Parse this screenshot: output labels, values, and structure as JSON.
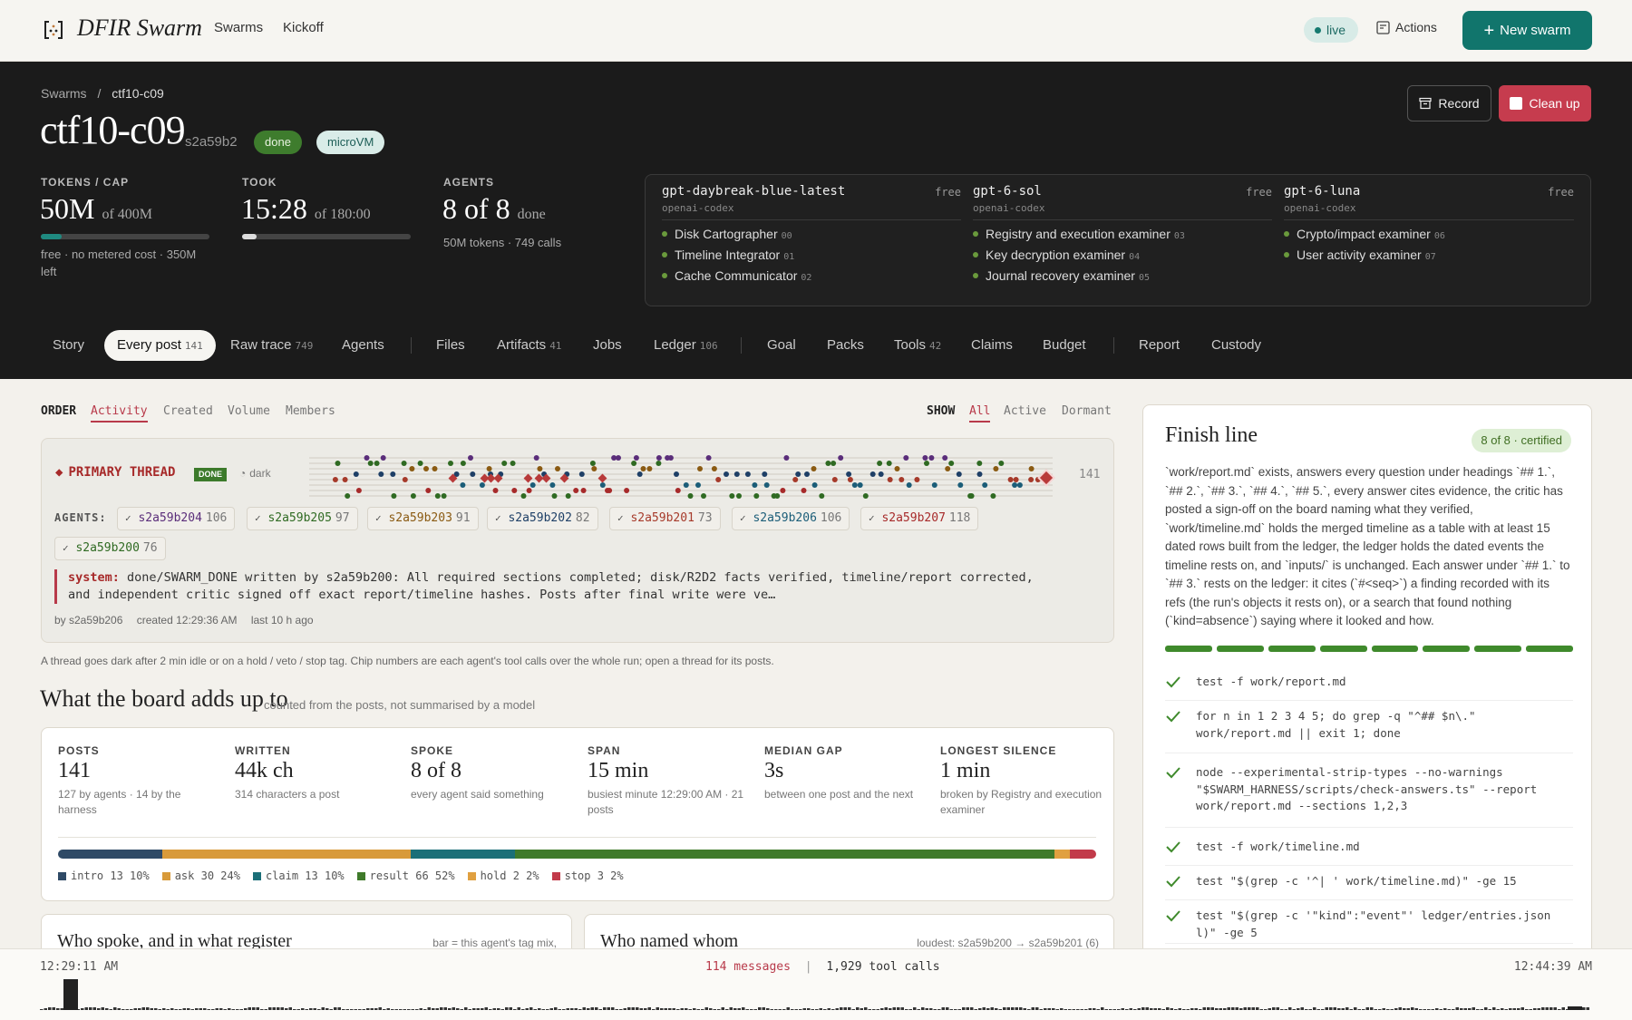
{
  "nav": {
    "brand": "DFIR Swarm",
    "links": [
      "Swarms",
      "Kickoff"
    ],
    "live": "live",
    "actions": "Actions",
    "new_swarm": "New swarm"
  },
  "header": {
    "breadcrumb": {
      "root": "Swarms",
      "sep": "/",
      "current": "ctf10-c09"
    },
    "title": "ctf10-c09",
    "id": "s2a59b2",
    "status": "done",
    "runtime": "microVM",
    "record": "Record",
    "cleanup": "Clean up",
    "stats": [
      {
        "label": "TOKENS / CAP",
        "value": "50M",
        "suffix": "of 400M",
        "sub": "free · no metered cost · 350M left",
        "progress": 0.125
      },
      {
        "label": "TOOK",
        "value": "15:28",
        "suffix": "of 180:00",
        "sub": "",
        "progress": 0.086
      },
      {
        "label": "AGENTS",
        "value": "8 of 8",
        "suffix": "done",
        "sub": "50M tokens · 749 calls"
      }
    ],
    "models": [
      {
        "name": "gpt-daybreak-blue-latest",
        "provider": "openai-codex",
        "tier": "free",
        "roles": [
          {
            "name": "Disk Cartographer",
            "n": "00"
          },
          {
            "name": "Timeline Integrator",
            "n": "01"
          },
          {
            "name": "Cache Communicator",
            "n": "02"
          }
        ]
      },
      {
        "name": "gpt-6-sol",
        "provider": "openai-codex",
        "tier": "free",
        "roles": [
          {
            "name": "Registry and execution examiner",
            "n": "03"
          },
          {
            "name": "Key decryption examiner",
            "n": "04"
          },
          {
            "name": "Journal recovery examiner",
            "n": "05"
          }
        ]
      },
      {
        "name": "gpt-6-luna",
        "provider": "openai-codex",
        "tier": "free",
        "roles": [
          {
            "name": "Crypto/impact examiner",
            "n": "06"
          },
          {
            "name": "User activity examiner",
            "n": "07"
          }
        ]
      }
    ],
    "tabs": [
      {
        "label": "Story",
        "count": ""
      },
      {
        "label": "Every post",
        "count": "141"
      },
      {
        "label": "Raw trace",
        "count": "749"
      },
      {
        "label": "Agents",
        "count": ""
      },
      {
        "label": "Files",
        "count": ""
      },
      {
        "label": "Artifacts",
        "count": "41"
      },
      {
        "label": "Jobs",
        "count": ""
      },
      {
        "label": "Ledger",
        "count": "106"
      },
      {
        "label": "Goal",
        "count": ""
      },
      {
        "label": "Packs",
        "count": ""
      },
      {
        "label": "Tools",
        "count": "42"
      },
      {
        "label": "Claims",
        "count": ""
      },
      {
        "label": "Budget",
        "count": ""
      },
      {
        "label": "Report",
        "count": ""
      },
      {
        "label": "Custody",
        "count": ""
      }
    ]
  },
  "order": {
    "label": "ORDER",
    "options": [
      "Activity",
      "Created",
      "Volume",
      "Members"
    ],
    "active": "Activity"
  },
  "show": {
    "label": "SHOW",
    "options": [
      "All",
      "Active",
      "Dormant"
    ],
    "active": "All"
  },
  "thread": {
    "title": "PRIMARY THREAD",
    "badge": "DONE",
    "dark": "dark",
    "count": "141",
    "agents_label": "AGENTS:",
    "agents": [
      {
        "id": "s2a59b204",
        "n": "106",
        "color": "#5a2d7a"
      },
      {
        "id": "s2a59b205",
        "n": "97",
        "color": "#2f6a22"
      },
      {
        "id": "s2a59b203",
        "n": "91",
        "color": "#8a5a12"
      },
      {
        "id": "s2a59b202",
        "n": "82",
        "color": "#1e3f66"
      },
      {
        "id": "s2a59b201",
        "n": "73",
        "color": "#a63a2a"
      },
      {
        "id": "s2a59b206",
        "n": "106",
        "color": "#1b5d78"
      },
      {
        "id": "s2a59b207",
        "n": "118",
        "color": "#a72a2a"
      },
      {
        "id": "s2a59b200",
        "n": "76",
        "color": "#2f6a22"
      }
    ],
    "system_label": "system:",
    "system_text": "done/SWARM_DONE written by s2a59b200: All required sections completed; disk/R2D2 facts verified, timeline/report corrected, and independent critic signed off exact report/timeline hashes. Posts after final write were ve…",
    "meta": {
      "by": "by s2a59b206",
      "created": "created 12:29:36 AM",
      "last": "last 10 h ago"
    }
  },
  "thread_note": "A thread goes dark after 2 min idle or on a hold / veto / stop tag. Chip numbers are each agent's tool calls over the whole run; open a thread for its posts.",
  "board": {
    "title": "What the board adds up to",
    "sub": "counted from the posts, not summarised by a model",
    "stats": [
      {
        "label": "POSTS",
        "value": "141",
        "sub": "127 by agents · 14 by the harness"
      },
      {
        "label": "WRITTEN",
        "value": "44k ch",
        "sub": "314 characters a post"
      },
      {
        "label": "SPOKE",
        "value": "8 of 8",
        "sub": "every agent said something"
      },
      {
        "label": "SPAN",
        "value": "15 min",
        "sub": "busiest minute 12:29:00 AM · 21 posts"
      },
      {
        "label": "MEDIAN GAP",
        "value": "3s",
        "sub": "between one post and the next"
      },
      {
        "label": "LONGEST SILENCE",
        "value": "1 min",
        "sub": "broken by Registry and execution examiner"
      }
    ],
    "segments": [
      {
        "name": "intro",
        "n": "13",
        "pct": "10%",
        "share": 10,
        "color": "#2f4a66"
      },
      {
        "name": "ask",
        "n": "30",
        "pct": "24%",
        "share": 24,
        "color": "#d89a3a"
      },
      {
        "name": "claim",
        "n": "13",
        "pct": "10%",
        "share": 10,
        "color": "#1b6f78"
      },
      {
        "name": "result",
        "n": "66",
        "pct": "52%",
        "share": 52,
        "color": "#3f7a2a"
      },
      {
        "name": "hold",
        "n": "2",
        "pct": "2%",
        "share": 1.5,
        "color": "#e0a040"
      },
      {
        "name": "stop",
        "n": "3",
        "pct": "2%",
        "share": 2.5,
        "color": "#c23a4a"
      }
    ]
  },
  "panels": [
    {
      "title": "Who spoke, and in what register",
      "note": "bar = this agent's tag mix,"
    },
    {
      "title": "Who named whom",
      "note": "loudest: s2a59b200 → s2a59b201 (6)"
    }
  ],
  "finish": {
    "title": "Finish line",
    "badge": "8 of 8 · certified",
    "body": "`work/report.md` exists, answers every question under headings `## 1.`, `## 2.`, `## 3.`, `## 4.`, `## 5.`, every answer cites evidence, the critic has posted a sign-off on the board naming what they verified, `work/timeline.md` holds the merged timeline as a table with at least 15 dated rows built from the ledger, the ledger holds the dated events the timeline rests on, and `inputs/` is unchanged. Each answer under `## 1.` to `## 3.` rests on the ledger: it cites (`#<seq>`) a finding recorded with its refs (the run's objects it rests on), or a search that found nothing (`kind=absence`) saying where it looked and how.",
    "certified": 8,
    "total": 8,
    "checks": [
      "test -f work/report.md",
      "for n in 1 2 3 4 5; do grep -q \"^## $n\\.\" work/report.md || exit 1; done",
      "node --experimental-strip-types --no-warnings \"$SWARM_HARNESS/scripts/check-answers.ts\" --report work/report.md --sections 1,2,3",
      "test -f work/timeline.md",
      "test \"$(grep -c '^| ' work/timeline.md)\" -ge 15",
      "test \"$(grep -c '\"kind\":\"event\"' ledger/entries.json l)\" -ge 5"
    ]
  },
  "timeline": {
    "start": "12:29:11 AM",
    "end": "12:44:39 AM",
    "messages": "114 messages",
    "sep": "|",
    "tool_calls": "1,929 tool calls"
  }
}
